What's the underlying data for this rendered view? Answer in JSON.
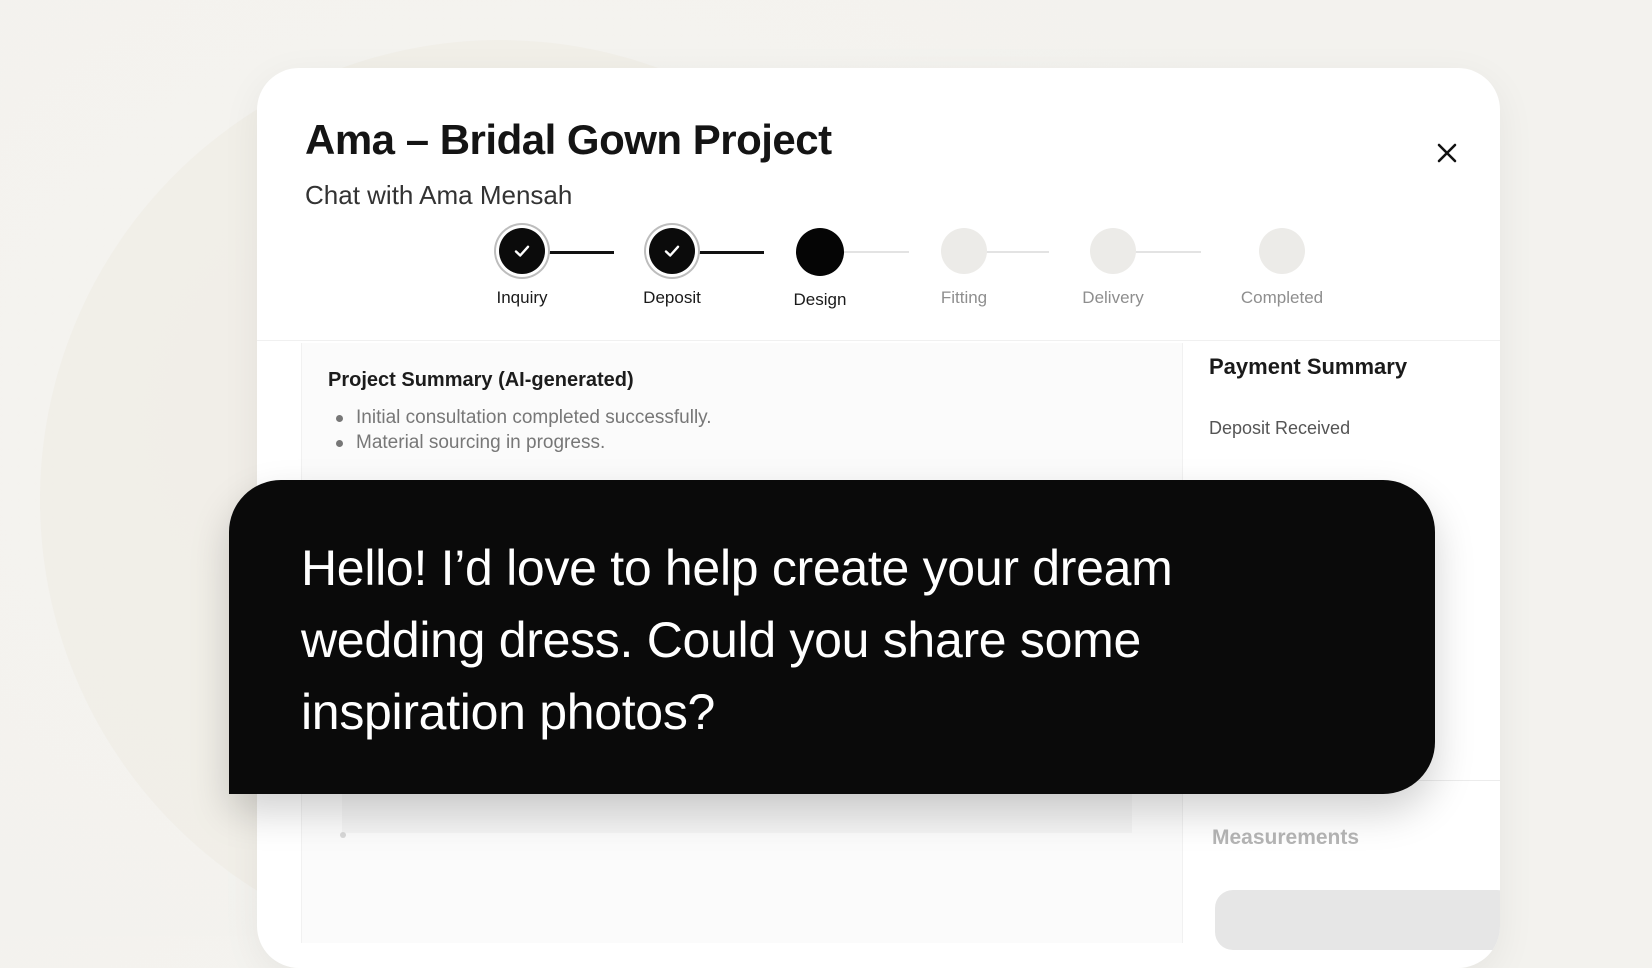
{
  "modal": {
    "title": "Ama – Bridal Gown Project",
    "subtitle": "Chat with Ama Mensah"
  },
  "stepper": {
    "steps": [
      {
        "label": "Inquiry",
        "state": "done"
      },
      {
        "label": "Deposit",
        "state": "done"
      },
      {
        "label": "Design",
        "state": "current"
      },
      {
        "label": "Fitting",
        "state": "todo"
      },
      {
        "label": "Delivery",
        "state": "todo"
      },
      {
        "label": "Completed",
        "state": "todo"
      }
    ]
  },
  "summary": {
    "title": "Project Summary (AI-generated)",
    "bullets": [
      "Initial consultation completed successfully.",
      "Material sourcing in progress."
    ]
  },
  "payment": {
    "title": "Payment Summary",
    "deposit_label": "Deposit Received"
  },
  "measurements": {
    "title": "Measurements"
  },
  "chat": {
    "message": "Hello! I’d love to help create your dream wedding dress. Could you share some inspiration photos?"
  },
  "icons": {
    "close": "close-icon",
    "check": "check-icon"
  }
}
